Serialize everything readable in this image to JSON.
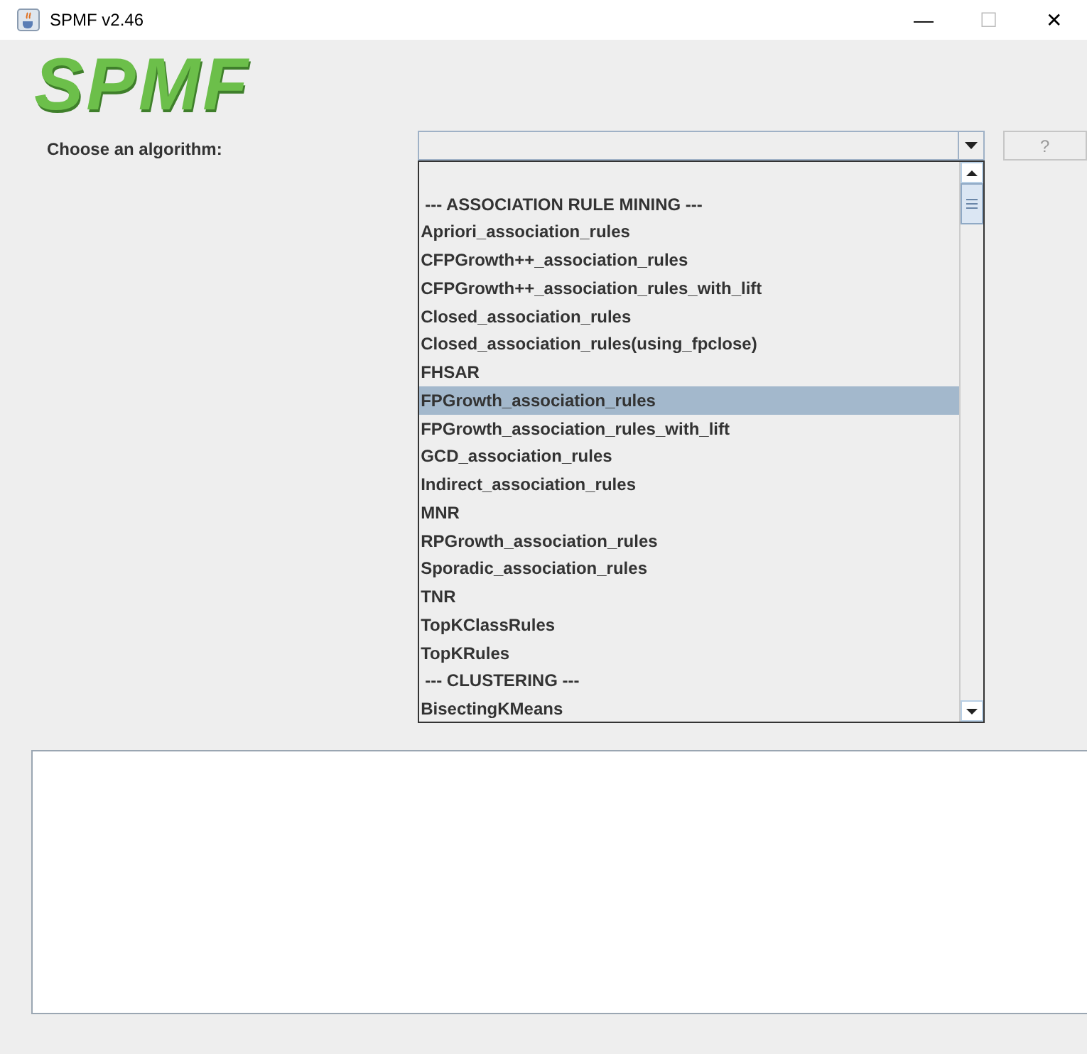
{
  "window": {
    "title": "SPMF v2.46",
    "controls": [
      "—",
      "☐",
      "✕"
    ]
  },
  "logo": "SPMF",
  "algorithm": {
    "label": "Choose an algorithm:",
    "help_button": "?",
    "dropdown": {
      "expanded": true,
      "items": [
        {
          "kind": "header",
          "text": "--- ASSOCIATION RULE MINING ---",
          "selected": false
        },
        {
          "kind": "item",
          "text": "Apriori_association_rules",
          "selected": false
        },
        {
          "kind": "item",
          "text": "CFPGrowth++_association_rules",
          "selected": false
        },
        {
          "kind": "item",
          "text": "CFPGrowth++_association_rules_with_lift",
          "selected": false
        },
        {
          "kind": "item",
          "text": "Closed_association_rules",
          "selected": false
        },
        {
          "kind": "item",
          "text": "Closed_association_rules(using_fpclose)",
          "selected": false
        },
        {
          "kind": "item",
          "text": "FHSAR",
          "selected": false
        },
        {
          "kind": "item",
          "text": "FPGrowth_association_rules",
          "selected": true
        },
        {
          "kind": "item",
          "text": "FPGrowth_association_rules_with_lift",
          "selected": false
        },
        {
          "kind": "item",
          "text": "GCD_association_rules",
          "selected": false
        },
        {
          "kind": "item",
          "text": "Indirect_association_rules",
          "selected": false
        },
        {
          "kind": "item",
          "text": "MNR",
          "selected": false
        },
        {
          "kind": "item",
          "text": "RPGrowth_association_rules",
          "selected": false
        },
        {
          "kind": "item",
          "text": "Sporadic_association_rules",
          "selected": false
        },
        {
          "kind": "item",
          "text": "TNR",
          "selected": false
        },
        {
          "kind": "item",
          "text": "TopKClassRules",
          "selected": false
        },
        {
          "kind": "item",
          "text": "TopKRules",
          "selected": false
        },
        {
          "kind": "header",
          "text": "--- CLUSTERING ---",
          "selected": false
        },
        {
          "kind": "item",
          "text": "BisectingKMeans",
          "selected": false
        }
      ]
    }
  }
}
